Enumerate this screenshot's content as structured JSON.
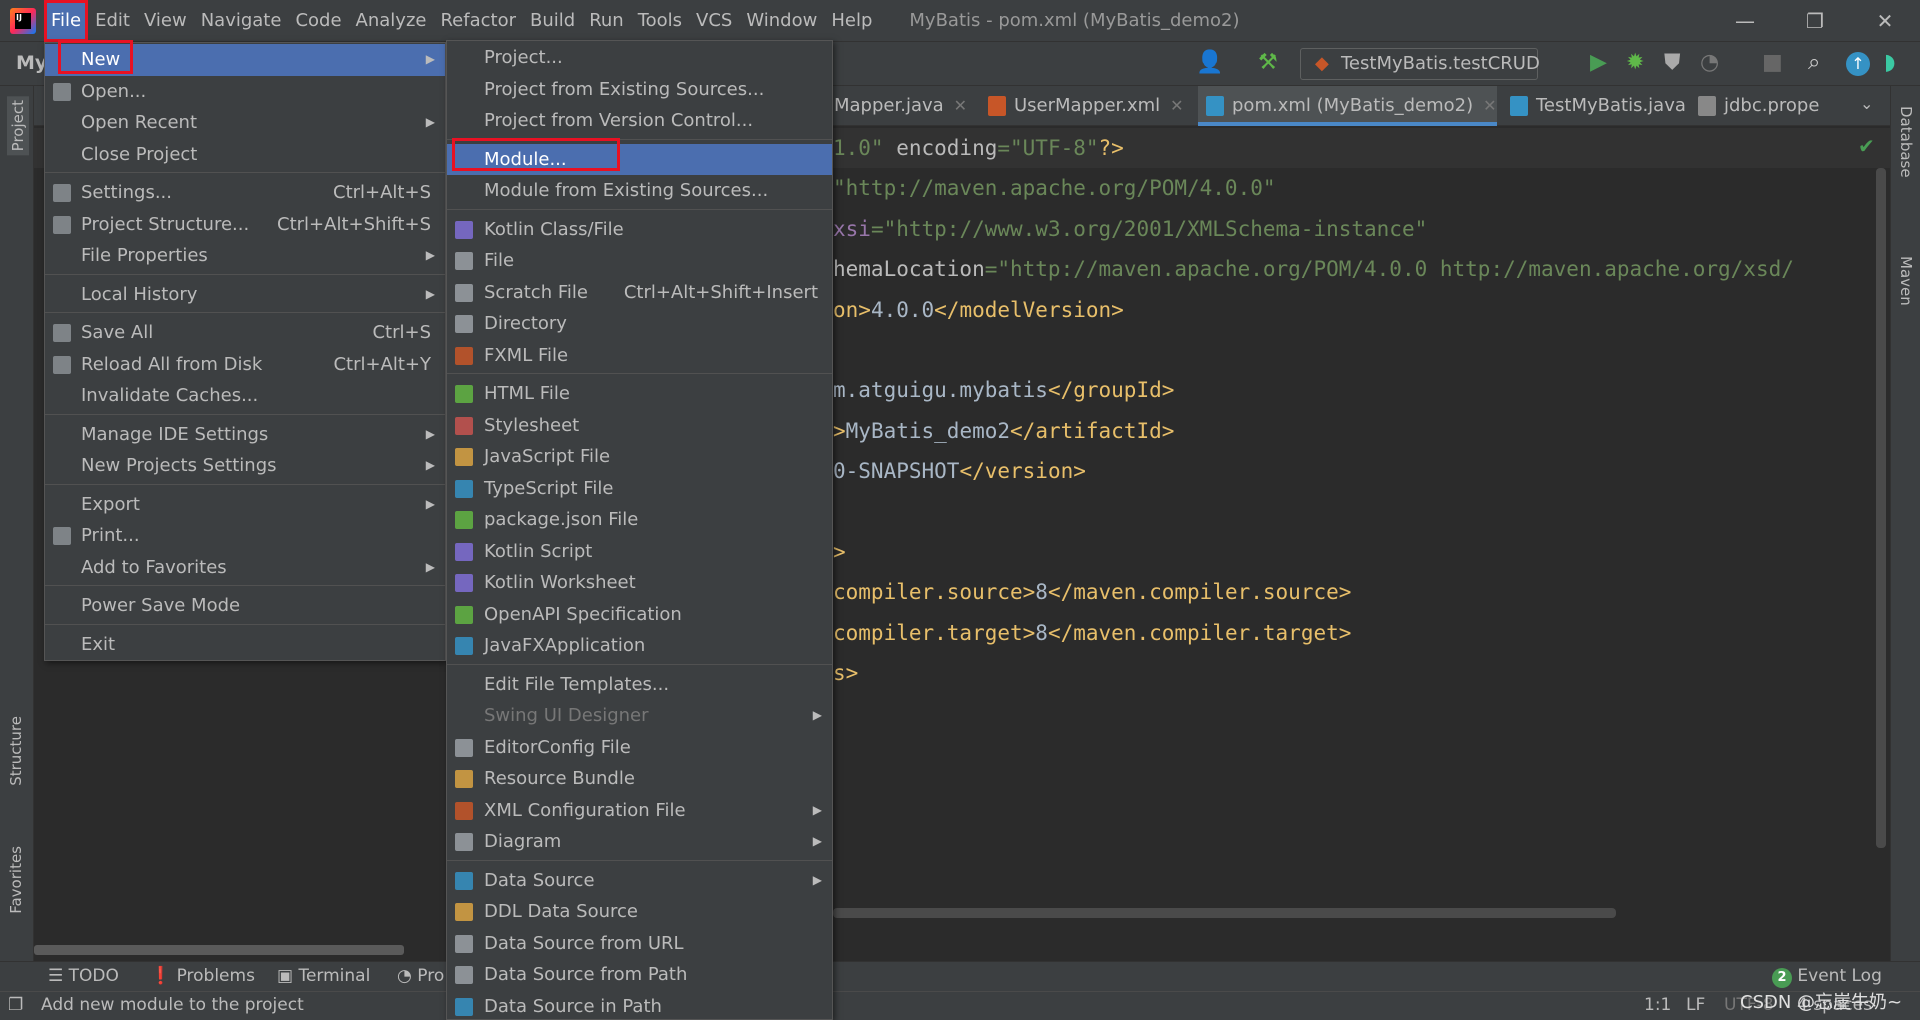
{
  "window": {
    "title": "MyBatis - pom.xml (MyBatis_demo2)",
    "minimize": "—",
    "restore": "❐",
    "close": "✕"
  },
  "menubar": [
    "File",
    "Edit",
    "View",
    "Navigate",
    "Code",
    "Analyze",
    "Refactor",
    "Build",
    "Run",
    "Tools",
    "VCS",
    "Window",
    "Help"
  ],
  "toolbar": {
    "project_label": "My",
    "run_config": "TestMyBatis.testCRUD"
  },
  "tabs": [
    {
      "label": "Mapper.java",
      "icon": "java-class-icon",
      "color": "#3592c4"
    },
    {
      "label": "UserMapper.xml",
      "icon": "xml-file-icon",
      "color": "#c75628"
    },
    {
      "label": "pom.xml (MyBatis_demo2)",
      "icon": "maven-icon",
      "color": "#3592c4",
      "active": true
    },
    {
      "label": "TestMyBatis.java",
      "icon": "test-class-icon",
      "color": "#3592c4"
    },
    {
      "label": "jdbc.prope",
      "icon": "properties-file-icon",
      "color": "#888888"
    }
  ],
  "side_tools": {
    "left_top": "Project",
    "left_mid": "Structure",
    "left_bottom": "Favorites",
    "right_top": "Database",
    "right_mid": "Maven"
  },
  "code_lines": [
    [
      [
        "1.0\"",
        "t-str"
      ],
      [
        " encoding",
        "t-attr"
      ],
      [
        "=\"UTF-8\"",
        "t-str"
      ],
      [
        "?>",
        "t-tag"
      ]
    ],
    [
      [
        "\"http://maven.apache.org/POM/4.0.0\"",
        "t-str"
      ]
    ],
    [
      [
        "xsi",
        "t-ns"
      ],
      [
        "=\"http://www.w3.org/2001/XMLSchema-instance\"",
        "t-str"
      ]
    ],
    [
      [
        "hemaLocation",
        "t-attr"
      ],
      [
        "=\"http://maven.apache.org/POM/4.0.0 http://maven.apache.org/xsd/",
        "t-str"
      ]
    ],
    [
      [
        "on>",
        "t-tag"
      ],
      [
        "4.0.0",
        "t-text"
      ],
      [
        "</modelVersion>",
        "t-tag"
      ]
    ],
    [],
    [
      [
        "m.atguigu.mybatis",
        "t-text"
      ],
      [
        "</groupId>",
        "t-tag"
      ]
    ],
    [
      [
        ">",
        "t-tag"
      ],
      [
        "MyBatis_demo2",
        "t-text"
      ],
      [
        "</artifactId>",
        "t-tag"
      ]
    ],
    [
      [
        "0-SNAPSHOT",
        "t-text"
      ],
      [
        "</version>",
        "t-tag"
      ]
    ],
    [],
    [
      [
        ">",
        "t-tag"
      ]
    ],
    [
      [
        "compiler.source>",
        "t-tag"
      ],
      [
        "8",
        "t-text"
      ],
      [
        "</maven.compiler.source>",
        "t-tag"
      ]
    ],
    [
      [
        "compiler.target>",
        "t-tag"
      ],
      [
        "8",
        "t-text"
      ],
      [
        "</maven.compiler.target>",
        "t-tag"
      ]
    ],
    [
      [
        "s>",
        "t-tag"
      ]
    ]
  ],
  "file_menu": [
    {
      "label": "New",
      "submenu": true,
      "highlighted": true
    },
    {
      "label": "Open...",
      "icon": "folder-open-icon"
    },
    {
      "label": "Open Recent",
      "submenu": true
    },
    {
      "label": "Close Project"
    },
    {
      "sep": true
    },
    {
      "label": "Settings...",
      "shortcut": "Ctrl+Alt+S",
      "icon": "wrench-icon"
    },
    {
      "label": "Project Structure...",
      "shortcut": "Ctrl+Alt+Shift+S",
      "icon": "project-structure-icon"
    },
    {
      "label": "File Properties",
      "submenu": true
    },
    {
      "sep": true
    },
    {
      "label": "Local History",
      "submenu": true
    },
    {
      "sep": true
    },
    {
      "label": "Save All",
      "shortcut": "Ctrl+S",
      "icon": "save-icon"
    },
    {
      "label": "Reload All from Disk",
      "shortcut": "Ctrl+Alt+Y",
      "icon": "reload-icon"
    },
    {
      "label": "Invalidate Caches..."
    },
    {
      "sep": true
    },
    {
      "label": "Manage IDE Settings",
      "submenu": true
    },
    {
      "label": "New Projects Settings",
      "submenu": true
    },
    {
      "sep": true
    },
    {
      "label": "Export",
      "submenu": true
    },
    {
      "label": "Print...",
      "icon": "print-icon"
    },
    {
      "label": "Add to Favorites",
      "submenu": true
    },
    {
      "sep": true
    },
    {
      "label": "Power Save Mode"
    },
    {
      "sep": true
    },
    {
      "label": "Exit"
    }
  ],
  "new_menu": [
    {
      "label": "Project..."
    },
    {
      "label": "Project from Existing Sources..."
    },
    {
      "label": "Project from Version Control..."
    },
    {
      "sep": true
    },
    {
      "label": "Module...",
      "highlighted": true
    },
    {
      "label": "Module from Existing Sources..."
    },
    {
      "sep": true
    },
    {
      "label": "Kotlin Class/File",
      "icon": "kotlin-file-icon",
      "color": "#7f6fd6"
    },
    {
      "label": "File",
      "icon": "file-icon",
      "color": "#9aa0a6"
    },
    {
      "label": "Scratch File",
      "shortcut": "Ctrl+Alt+Shift+Insert",
      "icon": "scratch-file-icon",
      "color": "#9aa0a6"
    },
    {
      "label": "Directory",
      "icon": "folder-icon",
      "color": "#9aa0a6"
    },
    {
      "label": "FXML File",
      "icon": "fxml-file-icon",
      "color": "#c75628"
    },
    {
      "sep": true
    },
    {
      "label": "HTML File",
      "icon": "html-file-icon",
      "color": "#62b543"
    },
    {
      "label": "Stylesheet",
      "icon": "css-file-icon",
      "color": "#c75450"
    },
    {
      "label": "JavaScript File",
      "icon": "js-file-icon",
      "color": "#d9a343"
    },
    {
      "label": "TypeScript File",
      "icon": "ts-file-icon",
      "color": "#3592c4"
    },
    {
      "label": "package.json File",
      "icon": "nodejs-icon",
      "color": "#62b543"
    },
    {
      "label": "Kotlin Script",
      "icon": "kotlin-script-icon",
      "color": "#7f6fd6"
    },
    {
      "label": "Kotlin Worksheet",
      "icon": "kotlin-worksheet-icon",
      "color": "#7f6fd6"
    },
    {
      "label": "OpenAPI Specification",
      "icon": "openapi-icon",
      "color": "#62b543"
    },
    {
      "label": "JavaFXApplication",
      "icon": "javafx-icon",
      "color": "#3592c4"
    },
    {
      "sep": true
    },
    {
      "label": "Edit File Templates..."
    },
    {
      "label": "Swing UI Designer",
      "submenu": true,
      "disabled": true
    },
    {
      "label": "EditorConfig File",
      "icon": "gear-icon",
      "color": "#9aa0a6"
    },
    {
      "label": "Resource Bundle",
      "icon": "resource-bundle-icon",
      "color": "#d9a343"
    },
    {
      "label": "XML Configuration File",
      "submenu": true,
      "icon": "xml-config-icon",
      "color": "#c75628"
    },
    {
      "label": "Diagram",
      "submenu": true,
      "icon": "diagram-icon",
      "color": "#9aa0a6"
    },
    {
      "sep": true
    },
    {
      "label": "Data Source",
      "submenu": true,
      "icon": "database-icon",
      "color": "#3592c4"
    },
    {
      "label": "DDL Data Source",
      "icon": "ddl-icon",
      "color": "#d9a343"
    },
    {
      "label": "Data Source from URL",
      "icon": "url-datasource-icon",
      "color": "#9aa0a6"
    },
    {
      "label": "Data Source from Path",
      "icon": "folder-open-icon",
      "color": "#9aa0a6"
    },
    {
      "label": "Data Source in Path",
      "icon": "database-icon",
      "color": "#3592c4"
    },
    {
      "sep": true
    },
    {
      "label": "",
      "icon": "file-icon",
      "color": "#9aa0a6"
    }
  ],
  "tool_windows": {
    "todo": "TODO",
    "problems": "Problems",
    "terminal": "Terminal",
    "profiler": "Pro",
    "event_log": "Event Log",
    "event_count": "2"
  },
  "status": {
    "message": "Add new module to the project",
    "position": "1:1",
    "line_sep": "LF",
    "encoding": "UTF-8",
    "indent": "4 spaces",
    "watermark": "CSDN @忘崖牛奶~"
  }
}
